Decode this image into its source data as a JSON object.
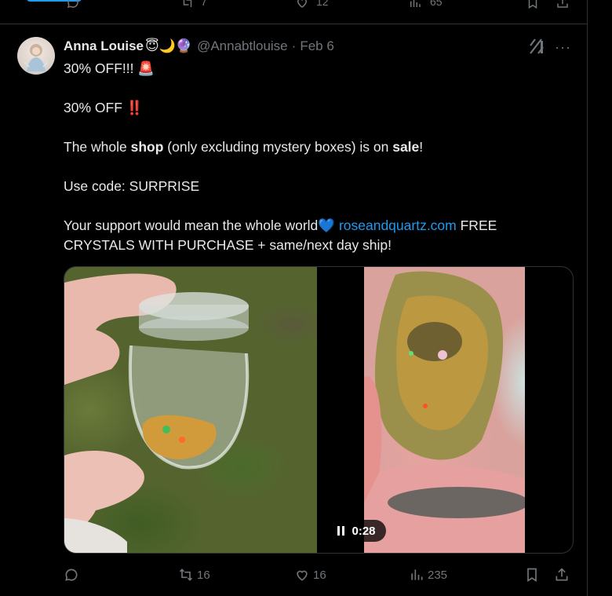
{
  "previous_tweet_actions": {
    "retweets": "7",
    "likes": "12",
    "views": "65"
  },
  "tweet": {
    "author_name": "Anna Louise",
    "author_emojis": "😇🌙🔮",
    "handle": "@Annabtlouise",
    "separator": "·",
    "date": "Feb 6",
    "more": "···",
    "lines": [
      {
        "text": "30% OFF!!! 🚨"
      },
      {
        "text": "30% OFF ‼️"
      },
      {
        "pre": "The whole ",
        "b1": "shop",
        "mid": " (only excluding mystery boxes) is on ",
        "b2": "sale",
        "post": "!"
      },
      {
        "text": "Use code: SURPRISE"
      },
      {
        "pre": "Your support would mean the whole world💙 ",
        "link": "roseandquartz.com",
        "post": " FREE CRYSTALS WITH PURCHASE + same/next day ship!"
      }
    ],
    "video": {
      "time": "0:28"
    },
    "actions": {
      "reply": "",
      "retweets": "16",
      "likes": "16",
      "views": "235"
    }
  },
  "colors": {
    "background": "#000000",
    "text": "#e7e9ea",
    "muted": "#71767b",
    "link": "#1d9bf0",
    "border": "#2f3336"
  },
  "icons": [
    "reply-icon",
    "retweet-icon",
    "like-icon",
    "views-icon",
    "bookmark-icon",
    "share-icon",
    "grok-icon",
    "more-icon",
    "pause-icon"
  ]
}
